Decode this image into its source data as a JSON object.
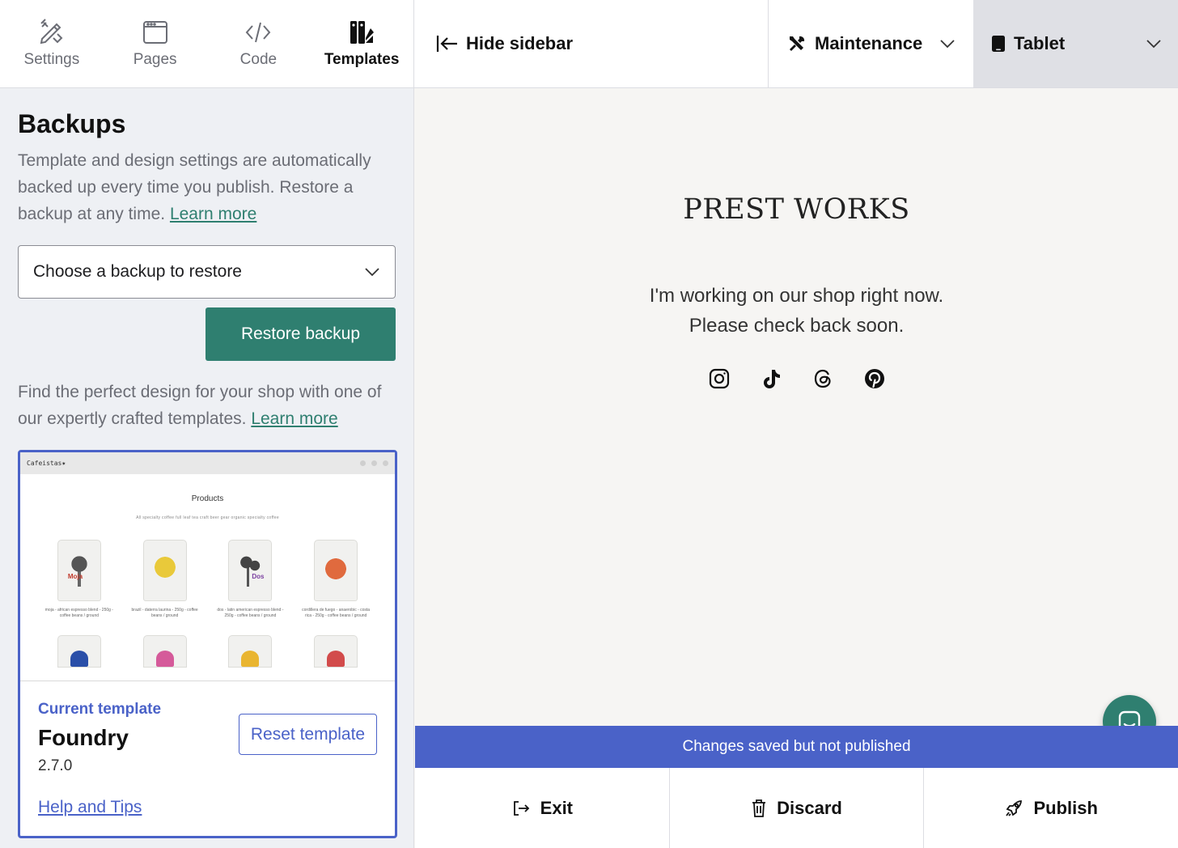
{
  "nav": {
    "tabs": [
      {
        "label": "Settings",
        "icon": "pencil-ruler-icon"
      },
      {
        "label": "Pages",
        "icon": "browser-window-icon"
      },
      {
        "label": "Code",
        "icon": "code-icon"
      },
      {
        "label": "Templates",
        "icon": "swatches-icon",
        "active": true
      }
    ]
  },
  "backups": {
    "heading": "Backups",
    "description": "Template and design settings are automatically backed up every time you publish. Restore a backup at any time.",
    "learn_more": "Learn more",
    "select_placeholder": "Choose a backup to restore",
    "restore_label": "Restore backup"
  },
  "templates": {
    "description": "Find the perfect design for your shop with one of our expertly crafted templates.",
    "learn_more": "Learn more",
    "preview": {
      "brand": "Cafeistas✷",
      "title": "Products",
      "filters": "All   specialty coffee   full leaf tea   craft beer   gear   organic specialty coffee",
      "products": [
        {
          "tag": "Moja",
          "caption": "moja - african espresso blend - 250g - coffee beans / ground",
          "color": "#3a3a3a"
        },
        {
          "tag": "",
          "caption": "brazil - daterra laurina - 250g - coffee beans / ground",
          "color": "#e9c93a"
        },
        {
          "tag": "Dos",
          "caption": "dos - latin american espresso blend - 250g - coffee beans / ground",
          "color": "#3a3a3a"
        },
        {
          "tag": "",
          "caption": "cordillera de fuego - anaerobic - costa rica - 250g - coffee beans / ground",
          "color": "#e06a3e"
        }
      ],
      "row2_colors": [
        "#2a4fa8",
        "#d55a9a",
        "#e9b531",
        "#d24b4b"
      ]
    },
    "current_label": "Current template",
    "current_name": "Foundry",
    "current_version": "2.7.0",
    "reset_label": "Reset template",
    "help_label": "Help and Tips"
  },
  "topbar": {
    "hide_sidebar": "Hide sidebar",
    "mode": "Maintenance",
    "device": "Tablet"
  },
  "preview": {
    "shop_name": "PREST WORKS",
    "message_line1": "I'm working on our shop right now.",
    "message_line2": "Please check back soon.",
    "socials": [
      "instagram-icon",
      "tiktok-icon",
      "threads-icon",
      "pinterest-icon"
    ]
  },
  "status": "Changes saved but not published",
  "actions": {
    "exit": "Exit",
    "discard": "Discard",
    "publish": "Publish"
  },
  "colors": {
    "accent_green": "#2f7f70",
    "accent_blue": "#4a62c8"
  }
}
